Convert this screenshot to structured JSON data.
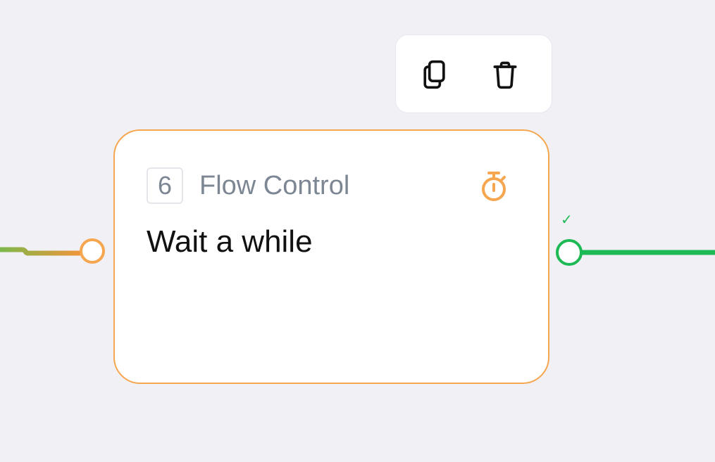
{
  "toolbar": {
    "copy_icon": "copy-icon",
    "delete_icon": "trash-icon"
  },
  "node": {
    "step_number": "6",
    "category": "Flow Control",
    "title": "Wait a while",
    "icon": "stopwatch-icon",
    "output_status": "✓"
  },
  "colors": {
    "node_border": "#f5a64f",
    "success": "#1db954",
    "incoming_edge_start": "#7bb84a",
    "muted_text": "#7d8794",
    "canvas_background": "#f1f1f5"
  }
}
